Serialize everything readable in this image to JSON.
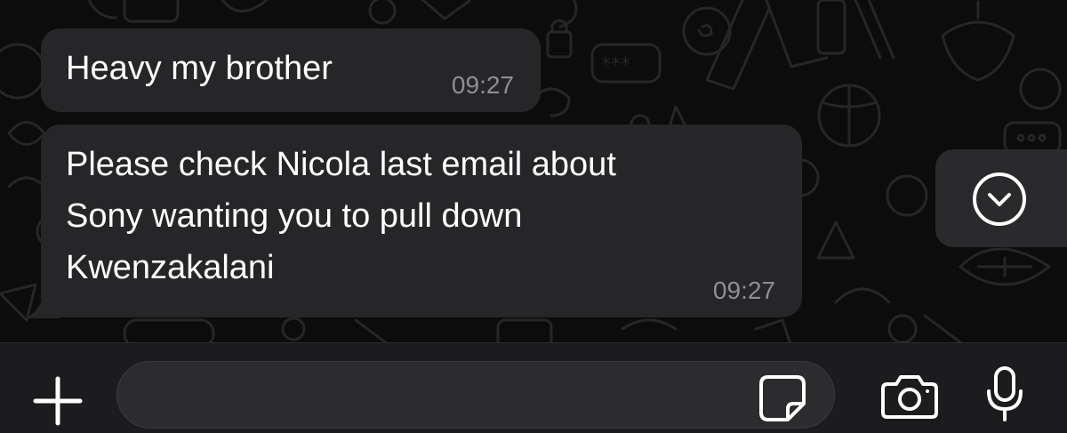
{
  "messages": [
    {
      "text": "Heavy my brother",
      "time": "09:27"
    },
    {
      "text": "Please check Nicola last email about\nSony wanting you to pull down\nKwenzakalani",
      "time": "09:27"
    }
  ],
  "composer": {
    "value": "",
    "placeholder": ""
  },
  "icons": {
    "add": "plus-icon",
    "sticker": "sticker-icon",
    "camera": "camera-icon",
    "mic": "microphone-icon",
    "scroll_down": "chevron-down-circle-icon"
  },
  "colors": {
    "background": "#0c0c0c",
    "bubble": "#262628",
    "timestamp": "#8e8e93",
    "toolbar": "#1c1c1e",
    "input": "#2c2c2e"
  }
}
